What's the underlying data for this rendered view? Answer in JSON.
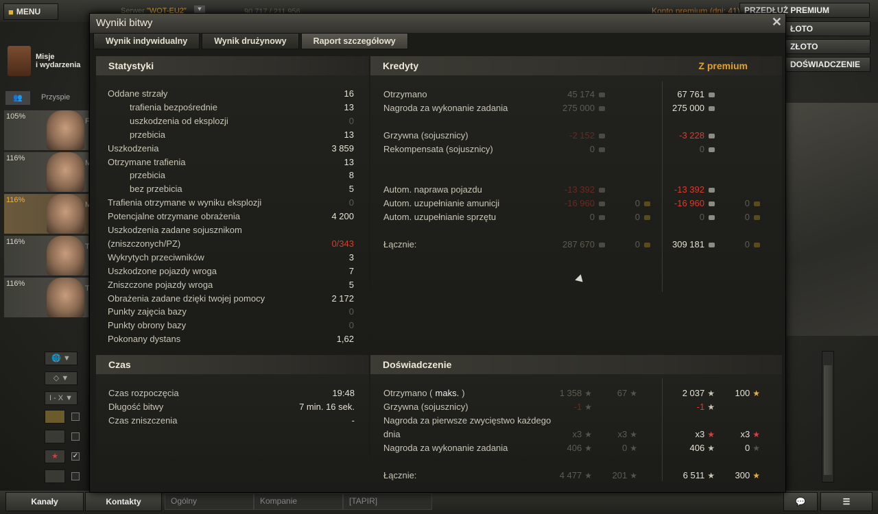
{
  "topbar": {
    "menu": "MENU",
    "server_label": "Serwer",
    "server_value": "\"WOT-EU2\"",
    "online": "90 717 / 211 956",
    "premium_account": "Konto premium (dni: 41)",
    "extend_premium": "PRZEDŁUŻ PREMIUM",
    "buy_gold": "ŁOTO",
    "exchange_gold": "ZŁOTO",
    "free_xp": "DOŚWIADCZENIE"
  },
  "missions": {
    "line1": "Misje",
    "line2": "i wydarzenia"
  },
  "left": {
    "accelerate": "Przyspie",
    "crew": [
      {
        "pct": "105%",
        "name": "F"
      },
      {
        "pct": "116%",
        "name": "M"
      },
      {
        "pct": "116%",
        "name": "M"
      },
      {
        "pct": "116%",
        "name": "T"
      },
      {
        "pct": "116%",
        "name": "T"
      }
    ],
    "tier_filter": "I - X"
  },
  "bottom": {
    "channels": "Kanały",
    "contacts": "Kontakty",
    "tab_general": "Ogólny",
    "tab_company": "Kompanie",
    "tab_clan": "[TAPIR]"
  },
  "dialog": {
    "title": "Wyniki bitwy",
    "tabs": [
      "Wynik indywidualny",
      "Wynik drużynowy",
      "Raport szczegółowy"
    ],
    "stats": {
      "header": "Statystyki",
      "rows": [
        {
          "label": "Oddane strzały",
          "value": "16",
          "indent": false,
          "style": "n"
        },
        {
          "label": "trafienia bezpośrednie",
          "value": "13",
          "indent": true,
          "style": "n"
        },
        {
          "label": "uszkodzenia od eksplozji",
          "value": "0",
          "indent": true,
          "style": "dim"
        },
        {
          "label": "przebicia",
          "value": "13",
          "indent": true,
          "style": "n"
        },
        {
          "label": "Uszkodzenia",
          "value": "3 859",
          "indent": false,
          "style": "n"
        },
        {
          "label": "Otrzymane trafienia",
          "value": "13",
          "indent": false,
          "style": "n"
        },
        {
          "label": "przebicia",
          "value": "8",
          "indent": true,
          "style": "n"
        },
        {
          "label": "bez przebicia",
          "value": "5",
          "indent": true,
          "style": "n"
        },
        {
          "label": "Trafienia otrzymane w wyniku eksplozji",
          "value": "0",
          "indent": false,
          "style": "dim"
        },
        {
          "label": "Potencjalne otrzymane obrażenia",
          "value": "4 200",
          "indent": false,
          "style": "n"
        },
        {
          "label": "Uszkodzenia zadane sojusznikom",
          "value": "",
          "indent": false,
          "style": "n"
        },
        {
          "label": "(zniszczonych/PZ)",
          "value": "0/343",
          "indent": false,
          "style": "red"
        },
        {
          "label": "Wykrytych przeciwników",
          "value": "3",
          "indent": false,
          "style": "n"
        },
        {
          "label": "Uszkodzone pojazdy wroga",
          "value": "7",
          "indent": false,
          "style": "n"
        },
        {
          "label": "Zniszczone pojazdy wroga",
          "value": "5",
          "indent": false,
          "style": "n"
        },
        {
          "label": "Obrażenia zadane dzięki twojej pomocy",
          "value": "2 172",
          "indent": false,
          "style": "n"
        },
        {
          "label": "Punkty zajęcia bazy",
          "value": "0",
          "indent": false,
          "style": "dim"
        },
        {
          "label": "Punkty obrony bazy",
          "value": "0",
          "indent": false,
          "style": "dim"
        },
        {
          "label": "Pokonany dystans",
          "value": "1,62",
          "indent": false,
          "style": "n"
        }
      ]
    },
    "credits": {
      "header": "Kredyty",
      "premium_label": "Z premium",
      "rows": [
        {
          "label": "Otrzymano",
          "c1": "45 174",
          "g1": "",
          "c2": "67 761",
          "g2": "",
          "c1s": "dim",
          "c2s": "n"
        },
        {
          "label": "Nagroda za wykonanie zadania",
          "c1": "275 000",
          "g1": "",
          "c2": "275 000",
          "g2": "",
          "c1s": "dim",
          "c2s": "n"
        },
        {
          "label": "",
          "c1": "",
          "g1": "",
          "c2": "",
          "g2": "",
          "c1s": "dim",
          "c2s": "n"
        },
        {
          "label": "Grzywna (sojusznicy)",
          "c1": "-2 152",
          "g1": "",
          "c2": "-3 228",
          "g2": "",
          "c1s": "dimred",
          "c2s": "red"
        },
        {
          "label": "Rekompensata (sojusznicy)",
          "c1": "0",
          "g1": "",
          "c2": "0",
          "g2": "",
          "c1s": "dim",
          "c2s": "dim"
        },
        {
          "label": "",
          "c1": "",
          "g1": "",
          "c2": "",
          "g2": "",
          "c1s": "dim",
          "c2s": "n"
        },
        {
          "label": "",
          "c1": "",
          "g1": "",
          "c2": "",
          "g2": "",
          "c1s": "dim",
          "c2s": "n"
        },
        {
          "label": "Autom. naprawa pojazdu",
          "c1": "-13 392",
          "g1": "",
          "c2": "-13 392",
          "g2": "",
          "c1s": "dimred",
          "c2s": "red"
        },
        {
          "label": "Autom. uzupełnianie amunicji",
          "c1": "-16 960",
          "g1": "0",
          "c2": "-16 960",
          "g2": "0",
          "c1s": "dimred",
          "c2s": "red"
        },
        {
          "label": "Autom. uzupełnianie sprzętu",
          "c1": "0",
          "g1": "0",
          "c2": "0",
          "g2": "0",
          "c1s": "dim",
          "c2s": "dim"
        },
        {
          "label": "",
          "c1": "",
          "g1": "",
          "c2": "",
          "g2": "",
          "c1s": "dim",
          "c2s": "n"
        },
        {
          "label": "Łącznie:",
          "c1": "287 670",
          "g1": "0",
          "c2": "309 181",
          "g2": "0",
          "c1s": "dim",
          "c2s": "n"
        }
      ]
    },
    "time": {
      "header": "Czas",
      "rows": [
        {
          "label": "Czas rozpoczęcia",
          "value": "19:48"
        },
        {
          "label": "Długość bitwy",
          "value": "7 min. 16 sek."
        },
        {
          "label": "Czas zniszczenia",
          "value": "-"
        }
      ]
    },
    "xp": {
      "header": "Doświadczenie",
      "rows": [
        {
          "label": "Otrzymano (",
          "label_b": "maks.",
          "label_c": ")",
          "x1": "1 358",
          "x2": "67",
          "x3": "2 037",
          "x4": "100",
          "s1": "dim",
          "s3": "n",
          "st1": "dim",
          "st2": "dim",
          "st3": "n",
          "st4": "hl"
        },
        {
          "label": "Grzywna (sojusznicy)",
          "label_b": "",
          "label_c": "",
          "x1": "-1",
          "x2": "",
          "x3": "-1",
          "x4": "",
          "s1": "dimred",
          "s3": "red",
          "st1": "dim",
          "st2": "",
          "st3": "n",
          "st4": ""
        },
        {
          "label": "Nagroda za pierwsze zwycięstwo każdego",
          "label_b": "",
          "label_c": "",
          "x1": "",
          "x2": "",
          "x3": "",
          "x4": "",
          "s1": "dim",
          "s3": "n",
          "st1": "",
          "st2": "",
          "st3": "",
          "st4": ""
        },
        {
          "label": "dnia",
          "label_b": "",
          "label_c": "",
          "x1": "x3",
          "x2": "x3",
          "x3": "x3",
          "x4": "x3",
          "s1": "dim",
          "s3": "n",
          "st1": "dim",
          "st2": "dim",
          "st3": "red",
          "st4": "red"
        },
        {
          "label": "Nagroda za wykonanie zadania",
          "label_b": "",
          "label_c": "",
          "x1": "406",
          "x2": "0",
          "x3": "406",
          "x4": "0",
          "s1": "dim",
          "s3": "n",
          "st1": "dim",
          "st2": "dim",
          "st3": "n",
          "st4": "dim"
        },
        {
          "label": "",
          "label_b": "",
          "label_c": "",
          "x1": "",
          "x2": "",
          "x3": "",
          "x4": "",
          "s1": "dim",
          "s3": "n",
          "st1": "",
          "st2": "",
          "st3": "",
          "st4": ""
        },
        {
          "label": "Łącznie:",
          "label_b": "",
          "label_c": "",
          "x1": "4 477",
          "x2": "201",
          "x3": "6 511",
          "x4": "300",
          "s1": "dim",
          "s3": "n",
          "st1": "dim",
          "st2": "dim",
          "st3": "n",
          "st4": "hl"
        }
      ]
    }
  }
}
